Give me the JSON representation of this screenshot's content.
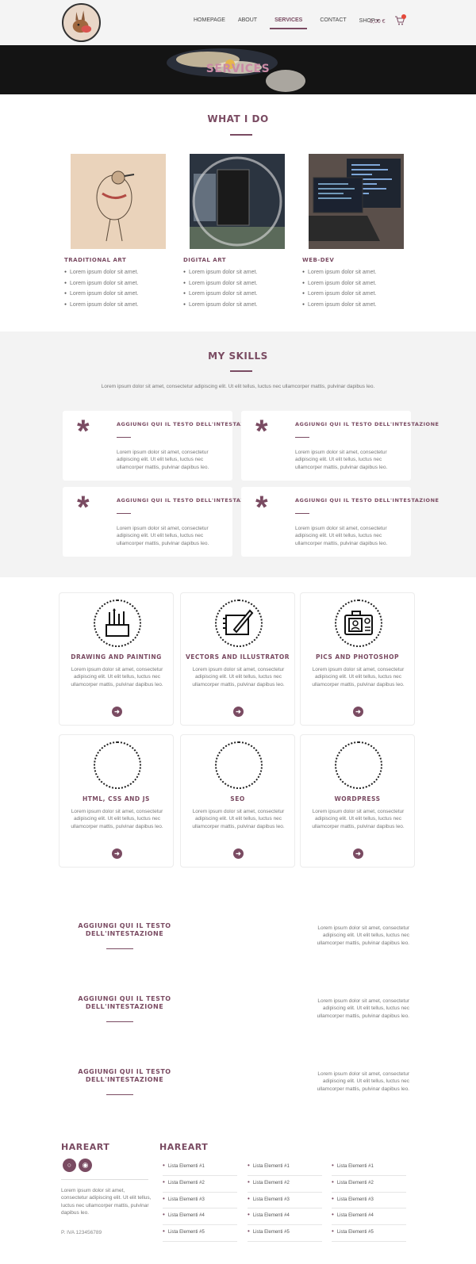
{
  "nav": {
    "items": [
      "HOMEPAGE",
      "ABOUT",
      "SERVICES",
      "CONTACT",
      "SHOP"
    ],
    "cart_total": "0,00 €"
  },
  "hero": {
    "title": "SERVICES"
  },
  "what_i_do": {
    "title": "WHAT I DO",
    "columns": [
      {
        "title": "TRADITIONAL ART",
        "items": [
          "Lorem ipsum dolor sit amet.",
          "Lorem ipsum dolor sit amet.",
          "Lorem ipsum dolor sit amet.",
          "Lorem ipsum dolor sit amet."
        ]
      },
      {
        "title": "DIGITAL ART",
        "items": [
          "Lorem ipsum dolor sit amet.",
          "Lorem ipsum dolor sit amet.",
          "Lorem ipsum dolor sit amet.",
          "Lorem ipsum dolor sit amet."
        ]
      },
      {
        "title": "WEB-DEV",
        "items": [
          "Lorem ipsum dolor sit amet.",
          "Lorem ipsum dolor sit amet.",
          "Lorem ipsum dolor sit amet.",
          "Lorem ipsum dolor sit amet."
        ]
      }
    ]
  },
  "skills": {
    "title": "MY SKILLS",
    "subtitle": "Lorem ipsum dolor sit amet, consectetur adipiscing elit. Ut elit tellus, luctus nec ullamcorper mattis, pulvinar dapibus leo.",
    "cards": [
      {
        "heading": "AGGIUNGI QUI IL TESTO DELL'INTESTAZIONE",
        "text": "Lorem ipsum dolor sit amet, consectetur adipiscing elit. Ut elit tellus, luctus nec ullamcorper mattis, pulvinar dapibus leo."
      },
      {
        "heading": "AGGIUNGI QUI IL TESTO DELL'INTESTAZIONE",
        "text": "Lorem ipsum dolor sit amet, consectetur adipiscing elit. Ut elit tellus, luctus nec ullamcorper mattis, pulvinar dapibus leo."
      },
      {
        "heading": "AGGIUNGI QUI IL TESTO DELL'INTESTAZIONE",
        "text": "Lorem ipsum dolor sit amet, consectetur adipiscing elit. Ut elit tellus, luctus nec ullamcorper mattis, pulvinar dapibus leo."
      },
      {
        "heading": "AGGIUNGI QUI IL TESTO DELL'INTESTAZIONE",
        "text": "Lorem ipsum dolor sit amet, consectetur adipiscing elit. Ut elit tellus, luctus nec ullamcorper mattis, pulvinar dapibus leo."
      }
    ]
  },
  "services": [
    {
      "title": "DRAWING AND PAINTING",
      "icon": "brushes-icon",
      "text": "Lorem ipsum dolor sit amet, consectetur adipiscing elit. Ut elit tellus, luctus nec ullamcorper mattis, pulvinar dapibus leo."
    },
    {
      "title": "VECTORS AND ILLUSTRATOR",
      "icon": "tablet-pen-icon",
      "text": "Lorem ipsum dolor sit amet, consectetur adipiscing elit. Ut elit tellus, luctus nec ullamcorper mattis, pulvinar dapibus leo."
    },
    {
      "title": "PICS AND PHOTOSHOP",
      "icon": "camera-icon",
      "text": "Lorem ipsum dolor sit amet, consectetur adipiscing elit. Ut elit tellus, luctus nec ullamcorper mattis, pulvinar dapibus leo."
    },
    {
      "title": "HTML, CSS AND JS",
      "icon": "empty-circle-icon",
      "text": "Lorem ipsum dolor sit amet, consectetur adipiscing elit. Ut elit tellus, luctus nec ullamcorper mattis, pulvinar dapibus leo."
    },
    {
      "title": "SEO",
      "icon": "empty-circle-icon",
      "text": "Lorem ipsum dolor sit amet, consectetur adipiscing elit. Ut elit tellus, luctus nec ullamcorper mattis, pulvinar dapibus leo."
    },
    {
      "title": "WORDPRESS",
      "icon": "empty-circle-icon",
      "text": "Lorem ipsum dolor sit amet, consectetur adipiscing elit. Ut elit tellus, luctus nec ullamcorper mattis, pulvinar dapibus leo."
    }
  ],
  "rows": [
    {
      "heading": "AGGIUNGI QUI IL TESTO DELL'INTESTAZIONE",
      "text": "Lorem ipsum dolor sit amet, consectetur adipiscing elit. Ut elit tellus, luctus nec ullamcorper mattis, pulvinar dapibus leo."
    },
    {
      "heading": "AGGIUNGI QUI IL TESTO DELL'INTESTAZIONE",
      "text": "Lorem ipsum dolor sit amet, consectetur adipiscing elit. Ut elit tellus, luctus nec ullamcorper mattis, pulvinar dapibus leo."
    },
    {
      "heading": "AGGIUNGI QUI IL TESTO DELL'INTESTAZIONE",
      "text": "Lorem ipsum dolor sit amet, consectetur adipiscing elit. Ut elit tellus, luctus nec ullamcorper mattis, pulvinar dapibus leo."
    }
  ],
  "footer": {
    "brand_left": "HAREART",
    "brand_right": "HAREART",
    "text": "Lorem ipsum dolor sit amet, consectetur adipiscing elit. Ut elit tellus, luctus nec ullamcorper mattis, pulvinar dapibus leo.",
    "vat": "P. IVA 123456789",
    "lists": [
      [
        "Lista Elementi #1",
        "Lista Elementi #2",
        "Lista Elementi #3",
        "Lista Elementi #4",
        "Lista Elementi #5"
      ],
      [
        "Lista Elementi #1",
        "Lista Elementi #2",
        "Lista Elementi #3",
        "Lista Elementi #4",
        "Lista Elementi #5"
      ],
      [
        "Lista Elementi #1",
        "Lista Elementi #2",
        "Lista Elementi #3",
        "Lista Elementi #4",
        "Lista Elementi #5"
      ]
    ]
  },
  "colors": {
    "accent": "#7a4b62",
    "hero_bg": "#141414",
    "band_bg": "#f3f3f3",
    "header_bg": "#f4f4f4"
  }
}
